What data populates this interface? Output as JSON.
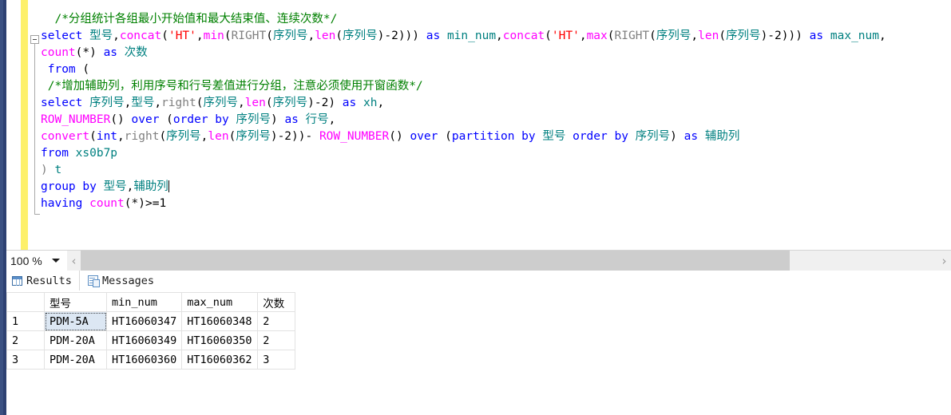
{
  "editor": {
    "zoom_level": "100 %",
    "lines": [
      [
        {
          "text": "  ",
          "cls": "t-plain"
        },
        {
          "text": "/*分组统计各组最小开始值和最大结束值、连续次数*/",
          "cls": "t-cmt"
        }
      ],
      [
        {
          "text": "select ",
          "cls": "t-kw"
        },
        {
          "text": "型号",
          "cls": "t-id"
        },
        {
          "text": ",",
          "cls": "t-plain"
        },
        {
          "text": "concat",
          "cls": "t-fn"
        },
        {
          "text": "(",
          "cls": "t-plain"
        },
        {
          "text": "'HT'",
          "cls": "t-str"
        },
        {
          "text": ",",
          "cls": "t-plain"
        },
        {
          "text": "min",
          "cls": "t-fn"
        },
        {
          "text": "(",
          "cls": "t-plain"
        },
        {
          "text": "RIGHT",
          "cls": "t-sys"
        },
        {
          "text": "(",
          "cls": "t-plain"
        },
        {
          "text": "序列号",
          "cls": "t-id"
        },
        {
          "text": ",",
          "cls": "t-plain"
        },
        {
          "text": "len",
          "cls": "t-fn"
        },
        {
          "text": "(",
          "cls": "t-plain"
        },
        {
          "text": "序列号",
          "cls": "t-id"
        },
        {
          "text": ")-2))) ",
          "cls": "t-plain"
        },
        {
          "text": "as ",
          "cls": "t-kw"
        },
        {
          "text": "min_num",
          "cls": "t-id"
        },
        {
          "text": ",",
          "cls": "t-plain"
        },
        {
          "text": "concat",
          "cls": "t-fn"
        },
        {
          "text": "(",
          "cls": "t-plain"
        },
        {
          "text": "'HT'",
          "cls": "t-str"
        },
        {
          "text": ",",
          "cls": "t-plain"
        },
        {
          "text": "max",
          "cls": "t-fn"
        },
        {
          "text": "(",
          "cls": "t-plain"
        },
        {
          "text": "RIGHT",
          "cls": "t-sys"
        },
        {
          "text": "(",
          "cls": "t-plain"
        },
        {
          "text": "序列号",
          "cls": "t-id"
        },
        {
          "text": ",",
          "cls": "t-plain"
        },
        {
          "text": "len",
          "cls": "t-fn"
        },
        {
          "text": "(",
          "cls": "t-plain"
        },
        {
          "text": "序列号",
          "cls": "t-id"
        },
        {
          "text": ")-2))) ",
          "cls": "t-plain"
        },
        {
          "text": "as ",
          "cls": "t-kw"
        },
        {
          "text": "max_num",
          "cls": "t-id"
        },
        {
          "text": ",",
          "cls": "t-plain"
        }
      ],
      [
        {
          "text": "count",
          "cls": "t-fn"
        },
        {
          "text": "(*) ",
          "cls": "t-plain"
        },
        {
          "text": "as ",
          "cls": "t-kw"
        },
        {
          "text": "次数",
          "cls": "t-id"
        }
      ],
      [
        {
          "text": " ",
          "cls": "t-plain"
        },
        {
          "text": "from",
          "cls": "t-kw"
        },
        {
          "text": " (",
          "cls": "t-plain"
        }
      ],
      [
        {
          "text": " ",
          "cls": "t-plain"
        },
        {
          "text": "/*增加辅助列，利用序号和行号差值进行分组，注意必须使用开窗函数*/",
          "cls": "t-cmt"
        }
      ],
      [
        {
          "text": "select ",
          "cls": "t-kw"
        },
        {
          "text": "序列号",
          "cls": "t-id"
        },
        {
          "text": ",",
          "cls": "t-plain"
        },
        {
          "text": "型号",
          "cls": "t-id"
        },
        {
          "text": ",",
          "cls": "t-plain"
        },
        {
          "text": "right",
          "cls": "t-sys"
        },
        {
          "text": "(",
          "cls": "t-plain"
        },
        {
          "text": "序列号",
          "cls": "t-id"
        },
        {
          "text": ",",
          "cls": "t-plain"
        },
        {
          "text": "len",
          "cls": "t-fn"
        },
        {
          "text": "(",
          "cls": "t-plain"
        },
        {
          "text": "序列号",
          "cls": "t-id"
        },
        {
          "text": ")-2) ",
          "cls": "t-plain"
        },
        {
          "text": "as ",
          "cls": "t-kw"
        },
        {
          "text": "xh",
          "cls": "t-id"
        },
        {
          "text": ",",
          "cls": "t-plain"
        }
      ],
      [
        {
          "text": "ROW_NUMBER",
          "cls": "t-fn"
        },
        {
          "text": "() ",
          "cls": "t-plain"
        },
        {
          "text": "over ",
          "cls": "t-kw"
        },
        {
          "text": "(",
          "cls": "t-plain"
        },
        {
          "text": "order by ",
          "cls": "t-kw"
        },
        {
          "text": "序列号",
          "cls": "t-id"
        },
        {
          "text": ") ",
          "cls": "t-plain"
        },
        {
          "text": "as ",
          "cls": "t-kw"
        },
        {
          "text": "行号",
          "cls": "t-id"
        },
        {
          "text": ",",
          "cls": "t-plain"
        }
      ],
      [
        {
          "text": "convert",
          "cls": "t-fn"
        },
        {
          "text": "(",
          "cls": "t-plain"
        },
        {
          "text": "int",
          "cls": "t-kw"
        },
        {
          "text": ",",
          "cls": "t-plain"
        },
        {
          "text": "right",
          "cls": "t-sys"
        },
        {
          "text": "(",
          "cls": "t-plain"
        },
        {
          "text": "序列号",
          "cls": "t-id"
        },
        {
          "text": ",",
          "cls": "t-plain"
        },
        {
          "text": "len",
          "cls": "t-fn"
        },
        {
          "text": "(",
          "cls": "t-plain"
        },
        {
          "text": "序列号",
          "cls": "t-id"
        },
        {
          "text": ")-2))- ",
          "cls": "t-plain"
        },
        {
          "text": "ROW_NUMBER",
          "cls": "t-fn"
        },
        {
          "text": "() ",
          "cls": "t-plain"
        },
        {
          "text": "over ",
          "cls": "t-kw"
        },
        {
          "text": "(",
          "cls": "t-plain"
        },
        {
          "text": "partition by ",
          "cls": "t-kw"
        },
        {
          "text": "型号",
          "cls": "t-id"
        },
        {
          "text": " ",
          "cls": "t-plain"
        },
        {
          "text": "order by ",
          "cls": "t-kw"
        },
        {
          "text": "序列号",
          "cls": "t-id"
        },
        {
          "text": ") ",
          "cls": "t-plain"
        },
        {
          "text": "as ",
          "cls": "t-kw"
        },
        {
          "text": "辅助列",
          "cls": "t-id"
        }
      ],
      [
        {
          "text": "from ",
          "cls": "t-kw"
        },
        {
          "text": "xs0b7p",
          "cls": "t-id"
        }
      ],
      [
        {
          "text": ") ",
          "cls": "t-sys"
        },
        {
          "text": "t",
          "cls": "t-id"
        }
      ],
      [
        {
          "text": "group by ",
          "cls": "t-kw"
        },
        {
          "text": "型号",
          "cls": "t-id"
        },
        {
          "text": ",",
          "cls": "t-plain"
        },
        {
          "text": "辅助列",
          "cls": "t-id"
        },
        {
          "text": "|CARET|",
          "cls": "t-plain"
        }
      ],
      [
        {
          "text": "having ",
          "cls": "t-kw"
        },
        {
          "text": "count",
          "cls": "t-fn"
        },
        {
          "text": "(*)",
          "cls": "t-plain"
        },
        {
          "text": ">=",
          "cls": "t-plain"
        },
        {
          "text": "1",
          "cls": "t-num"
        }
      ]
    ]
  },
  "tabs": [
    {
      "label": "Results",
      "icon": "grid-icon",
      "active": true
    },
    {
      "label": "Messages",
      "icon": "document-icon",
      "active": false
    }
  ],
  "results": {
    "columns": [
      "",
      "型号",
      "min_num",
      "max_num",
      "次数"
    ],
    "rows": [
      {
        "num": "1",
        "cells": [
          "PDM-5A",
          "HT16060347",
          "HT16060348",
          "2"
        ],
        "selected_index": 0
      },
      {
        "num": "2",
        "cells": [
          "PDM-20A",
          "HT16060349",
          "HT16060350",
          "2"
        ],
        "selected_index": -1
      },
      {
        "num": "3",
        "cells": [
          "PDM-20A",
          "HT16060360",
          "HT16060362",
          "3"
        ],
        "selected_index": -1
      }
    ]
  },
  "scrollbar": {
    "left_arrow": "‹",
    "right_arrow": "›"
  },
  "colors": {
    "comment": "#008000",
    "keyword": "#0000ff",
    "function": "#ff00ff",
    "system_function": "#808080",
    "string": "#ff0000",
    "identifier": "#008080",
    "change_bar": "#fdf06a",
    "selection": "#dce7f3"
  }
}
